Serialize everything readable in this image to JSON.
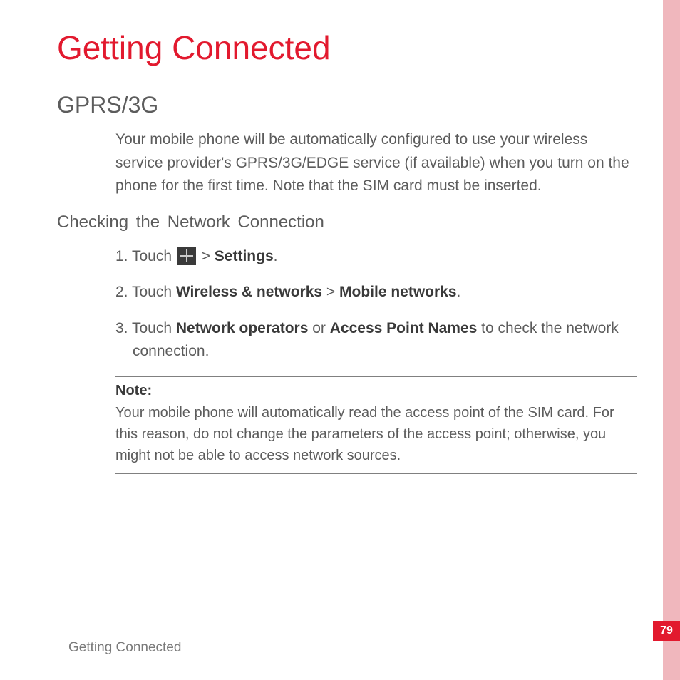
{
  "page": {
    "number": "79",
    "footer": "Getting Connected"
  },
  "chapter": {
    "title": "Getting Connected"
  },
  "section": {
    "title": "GPRS/3G",
    "intro": "Your mobile phone will be automatically configured to use your wireless service provider's GPRS/3G/EDGE service (if available) when you turn on the phone for the first time. Note that the SIM card must be inserted."
  },
  "subsection": {
    "title": "Checking  the  Network  Connection",
    "steps": {
      "s1_prefix": "1. Touch ",
      "s1_mid": " > ",
      "s1_bold": "Settings",
      "s1_suffix": ".",
      "s2_prefix": "2. Touch ",
      "s2_b1": "Wireless & networks",
      "s2_mid": " > ",
      "s2_b2": "Mobile networks",
      "s2_suffix": ".",
      "s3_prefix": "3. Touch ",
      "s3_b1": "Network operators",
      "s3_mid": " or ",
      "s3_b2": "Access Point Names",
      "s3_suffix": " to check the network connection."
    }
  },
  "note": {
    "label": "Note:",
    "text": "Your mobile phone will automatically read the access point of the SIM card. For this reason, do not change the parameters of the access point; otherwise, you might not be able to access network sources."
  },
  "icons": {
    "apps": "apps-grid-icon"
  }
}
